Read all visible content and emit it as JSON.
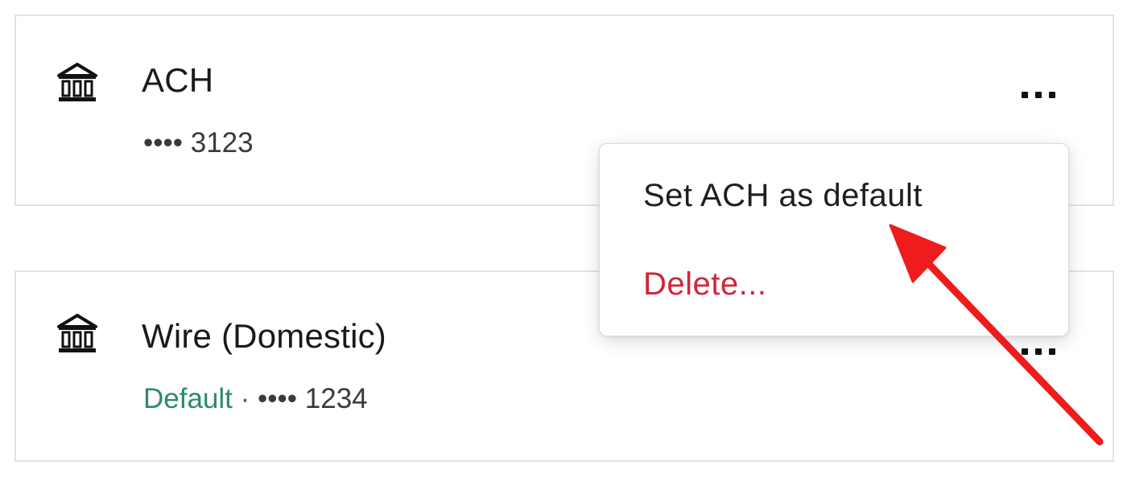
{
  "payment_methods": [
    {
      "title": "ACH",
      "masked_prefix": "•••• ",
      "last4": "3123",
      "icon": "bank-icon"
    },
    {
      "title": "Wire (Domestic)",
      "default_label": "Default",
      "separator": " · ",
      "masked_prefix": "•••• ",
      "last4": "1234",
      "icon": "bank-icon"
    }
  ],
  "menu": {
    "set_default_label": "Set ACH as default",
    "delete_label": "Delete..."
  },
  "colors": {
    "default_green": "#2e8a6e",
    "delete_red": "#d0263a",
    "annotation_arrow": "#ee1c1c"
  },
  "icons": {
    "more": "more-options-icon",
    "bank": "bank-icon",
    "annotation": "red-arrow-annotation"
  }
}
